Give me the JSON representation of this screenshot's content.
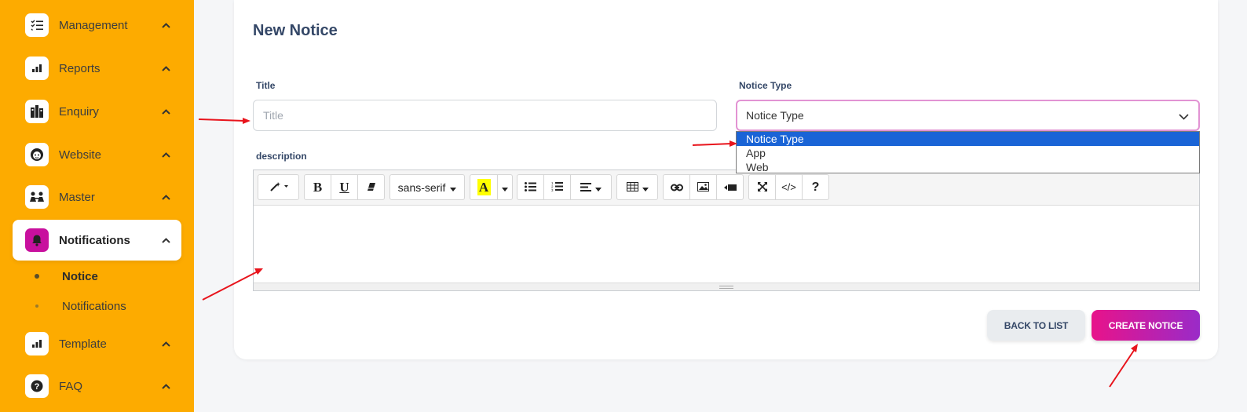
{
  "sidebar": {
    "items": [
      {
        "label": "Management",
        "icon": "checklist-icon"
      },
      {
        "label": "Reports",
        "icon": "bar-chart-icon"
      },
      {
        "label": "Enquiry",
        "icon": "building-icon"
      },
      {
        "label": "Website",
        "icon": "face-icon"
      },
      {
        "label": "Master",
        "icon": "people-icon"
      },
      {
        "label": "Notifications",
        "icon": "bell-icon"
      },
      {
        "label": "Template",
        "icon": "bar-chart-icon"
      },
      {
        "label": "FAQ",
        "icon": "question-circle-icon"
      }
    ],
    "sub_items": [
      {
        "label": "Notice"
      },
      {
        "label": "Notifications"
      }
    ]
  },
  "form": {
    "title": "New Notice",
    "title_label": "Title",
    "title_placeholder": "Title",
    "notice_type_label": "Notice Type",
    "notice_type_selected": "Notice Type",
    "notice_type_options": [
      "Notice Type",
      "App",
      "Web"
    ],
    "description_label": "description",
    "font_name": "sans-serif"
  },
  "buttons": {
    "back": "BACK TO LIST",
    "create": "CREATE NOTICE"
  },
  "colors": {
    "sidebar_bg": "#fdab00",
    "accent": "#c8109e",
    "create_gradient_start": "#e8138a",
    "create_gradient_end": "#9a2bc8",
    "arrow": "#e8141c"
  }
}
